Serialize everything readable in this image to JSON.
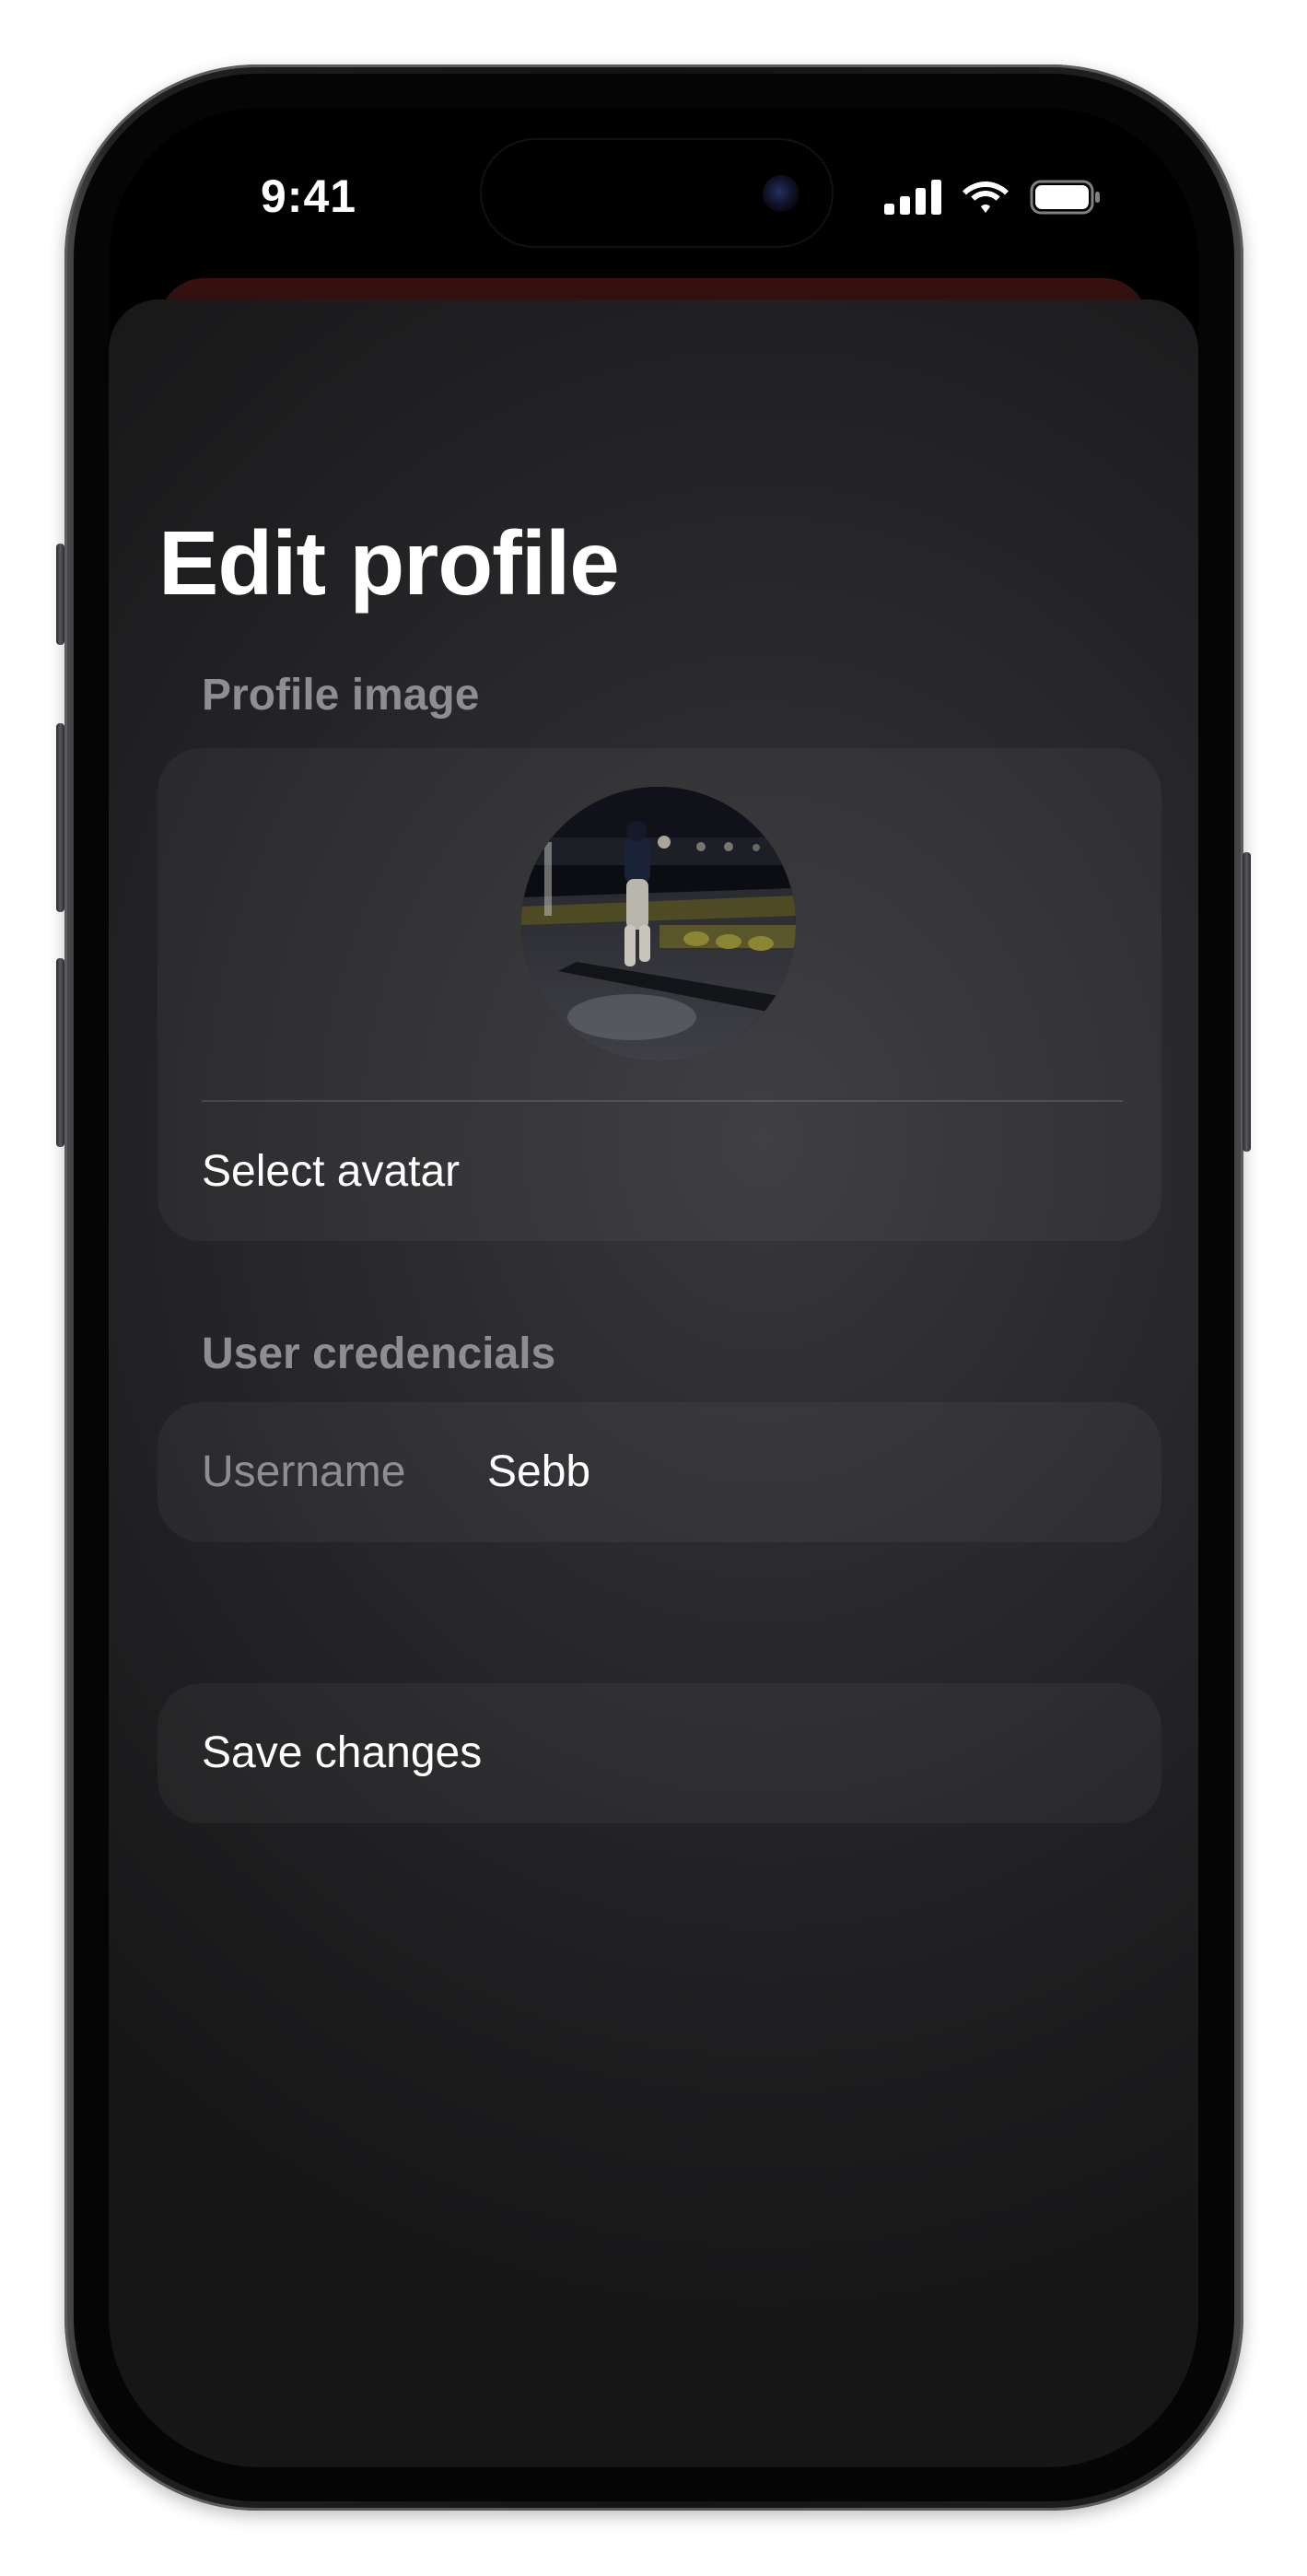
{
  "status_bar": {
    "time": "9:41",
    "icons": [
      "cellular-signal-icon",
      "wifi-icon",
      "battery-icon"
    ]
  },
  "page": {
    "title": "Edit profile"
  },
  "profile_image_section": {
    "header": "Profile image",
    "avatar_description": "avatar-photo",
    "select_label": "Select avatar"
  },
  "credentials_section": {
    "header": "User credencials",
    "username_label": "Username",
    "username_value": "Sebb"
  },
  "actions": {
    "save_label": "Save changes"
  },
  "colors": {
    "text_primary": "#ffffff",
    "text_secondary": "#8e8d92",
    "sheet_background": "#2b2a2e"
  }
}
